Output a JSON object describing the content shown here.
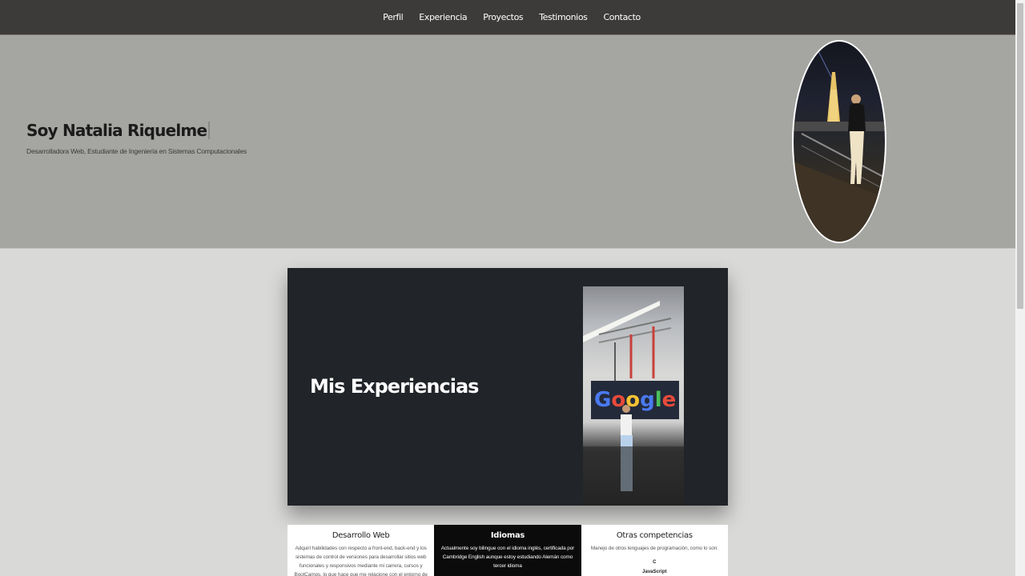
{
  "nav": {
    "items": [
      {
        "label": "Perfil"
      },
      {
        "label": "Experiencia"
      },
      {
        "label": "Proyectos"
      },
      {
        "label": "Testimonios"
      },
      {
        "label": "Contacto"
      }
    ]
  },
  "hero": {
    "title": "Soy Natalia Riquelme",
    "subtitle": "Desarrolladora Web, Estudiante de Ingeniería en Sistemas Computacionales"
  },
  "experience": {
    "title": "Mis Experiencias"
  },
  "skills": [
    {
      "title": "Desarrollo Web",
      "text": "Adquirí habilidades con respecto a front-end, back-end y los sistemas de control de versiones para desarrollar sitios web funcionales y responsivos mediante mi carrera, cursos y BootCamps, lo que hace que me relacione con el entorno de"
    },
    {
      "title": "Idiomas",
      "text": "Actualmente soy bilingue con el idioma inglés, certificada por Cambridge English aunque estoy estudiando Alemán como tercer idioma"
    },
    {
      "title": "Otras competencias",
      "text": "Manejo de otros lenguajes de programación, como lo son:",
      "list": [
        "C",
        "JavaScript"
      ]
    }
  ],
  "colors": {
    "navbar_bg": "#3d3b39",
    "hero_bg": "#a5a5a1",
    "page_bg": "#d9d9d7",
    "card_bg": "#212428"
  }
}
